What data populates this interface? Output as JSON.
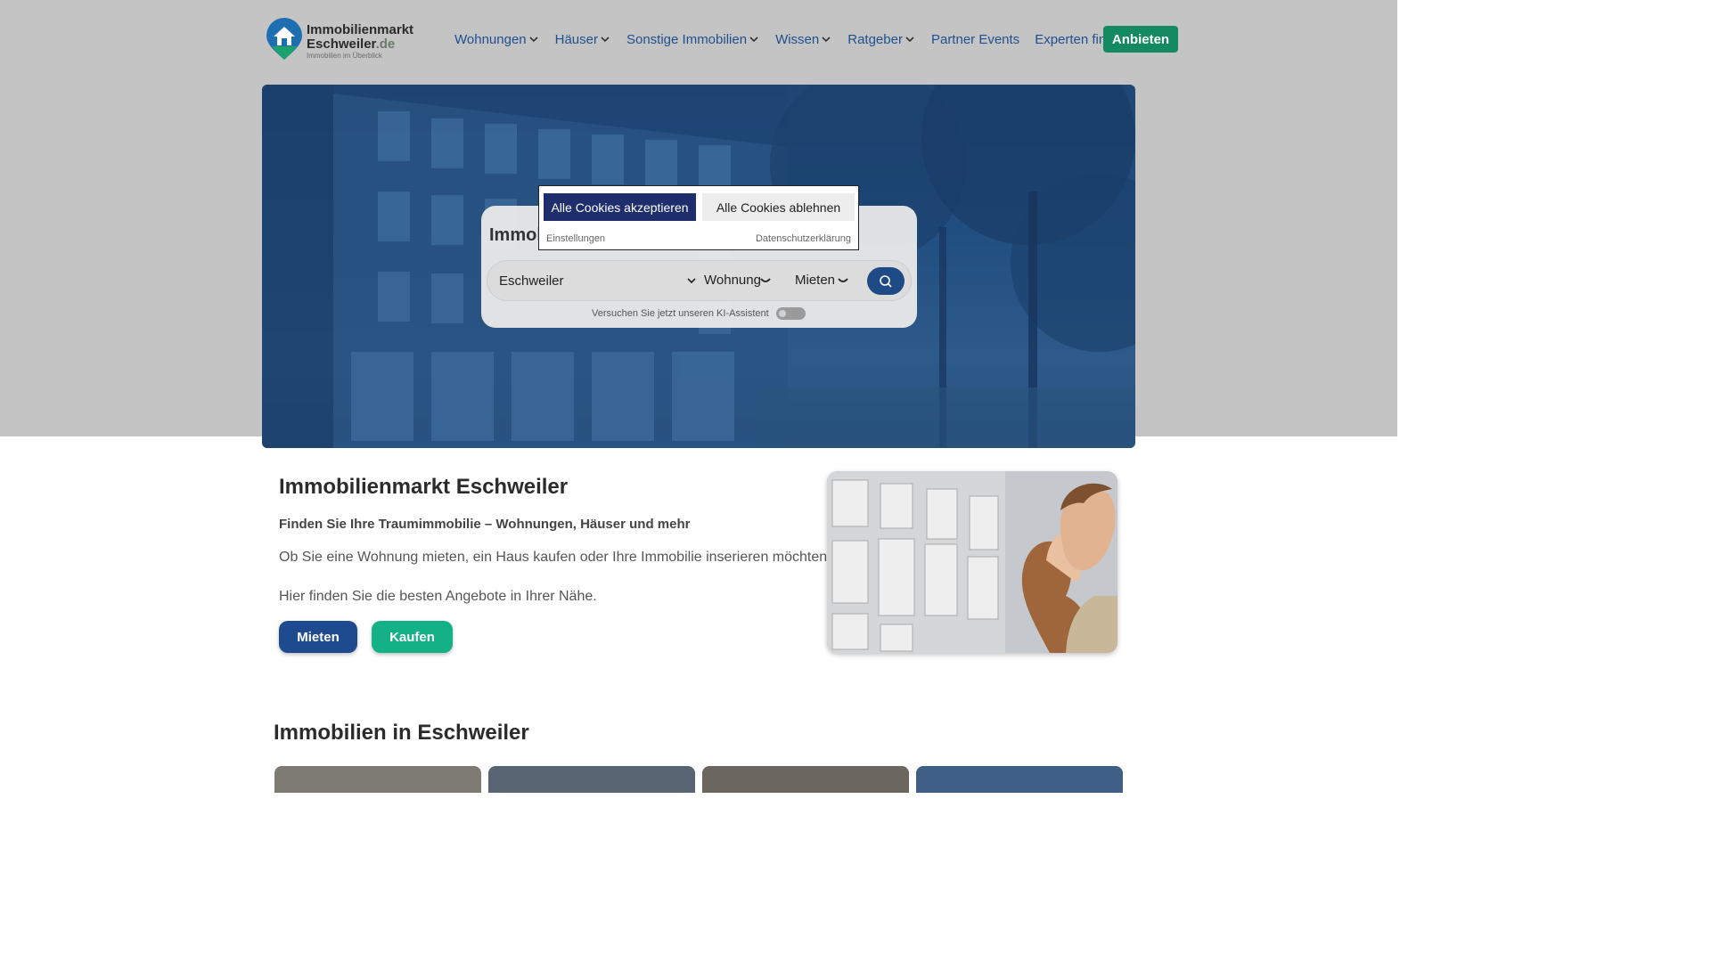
{
  "logo": {
    "line1": "Immobilienmarkt",
    "line2": "Eschweiler",
    "tld": ".de",
    "tagline": "Immobilien im Überblick",
    "icon": "house-pin-icon"
  },
  "nav": {
    "items": [
      {
        "label": "Wohnungen",
        "dropdown": true
      },
      {
        "label": "Häuser",
        "dropdown": true
      },
      {
        "label": "Sonstige Immobilien",
        "dropdown": true
      },
      {
        "label": "Wissen",
        "dropdown": true
      },
      {
        "label": "Ratgeber",
        "dropdown": true
      },
      {
        "label": "Partner Events",
        "dropdown": false
      },
      {
        "label": "Experten finden",
        "dropdown": false
      }
    ],
    "cta": "Anbieten"
  },
  "search": {
    "title": "Immobilienmarkt Eschweiler",
    "location_value": "Eschweiler",
    "type_value": "Wohnung",
    "mode_value": "Mieten",
    "ki_label": "Versuchen Sie jetzt unseren KI-Assistent",
    "ki_enabled": false
  },
  "cookie": {
    "accept": "Alle Cookies akzeptieren",
    "decline": "Alle Cookies ablehnen",
    "settings": "Einstellungen",
    "privacy": "Datenschutzerklärung"
  },
  "intro": {
    "title": "Immobilienmarkt Eschweiler",
    "subtitle": "Finden Sie Ihre Traumimmobilie – Wohnungen, Häuser und mehr",
    "p1": "Ob Sie eine Wohnung mieten, ein Haus kaufen oder Ihre Immobilie inserieren möchten:",
    "p2": "Hier finden Sie die besten Angebote in Ihrer Nähe.",
    "btn_rent": "Mieten",
    "btn_buy": "Kaufen"
  },
  "listings": {
    "title": "Immobilien in Eschweiler"
  },
  "colors": {
    "brand_blue": "#1e4a8f",
    "brand_green": "#138a62",
    "nav_blue": "#1f4f8f",
    "cookie_navy": "#1e2d6b"
  }
}
